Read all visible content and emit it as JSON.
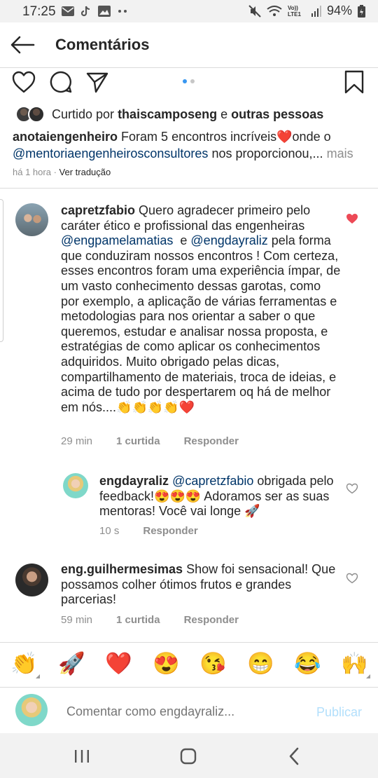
{
  "status_bar": {
    "time": "17:25",
    "network": "Vo)) LTE1",
    "battery": "94%"
  },
  "header": {
    "title": "Comentários",
    "back_icon": "arrow-left-icon"
  },
  "post": {
    "carousel_pages": 2,
    "carousel_active": 1,
    "liked_by_prefix": "Curtido por",
    "liked_by_user": "thaiscamposeng",
    "liked_by_connector": "e",
    "liked_by_others": "outras pessoas",
    "caption_user": "anotaiengenheiro",
    "caption_text": "Foram 5 encontros incríveis❤️onde o",
    "caption_mention": "@mentoriaengenheirosconsultores",
    "caption_text2": "nos proporcionou,...",
    "caption_more": "mais",
    "time_ago": "há 1 hora",
    "meta_sep": "·",
    "translate": "Ver tradução"
  },
  "comments": [
    {
      "user": "capretzfabio",
      "text_1": "Quero agradecer primeiro pelo caráter ético e profissional das engenheiras",
      "mention_1": "@engpamelamatias",
      "text_2": "e",
      "mention_2": "@engdayraliz",
      "text_3": "pela forma que conduziram nossos encontros ! Com certeza, esses encontros foram uma experiência ímpar, de um vasto conhecimento dessas garotas, como por exemplo, a aplicação de várias ferramentas e metodologias para nos orientar a saber o que queremos, estudar e analisar nossa proposta, e  estratégias de como aplicar os conhecimentos adquiridos. Muito obrigado pelas dicas, compartilhamento de materiais, troca de ideias, e acima de tudo por despertarem oq há de melhor em nós....👏👏👏👏❤️",
      "time": "29 min",
      "likes": "1 curtida",
      "reply": "Responder",
      "liked": true
    },
    {
      "user": "engdayraliz",
      "mention_1": "@capretzfabio",
      "text_1": "obrigada pelo feedback!😍😍😍 Adoramos ser as suas mentoras! Você vai longe 🚀",
      "time": "10 s",
      "reply": "Responder",
      "liked": false
    },
    {
      "user": "eng.guilhermesimas",
      "text_1": "Show foi sensacional! Que possamos colher ótimos frutos e grandes parcerias!",
      "time": "59 min",
      "likes": "1 curtida",
      "reply": "Responder",
      "liked": false
    }
  ],
  "emoji_bar": [
    "👏",
    "🚀",
    "❤️",
    "😍",
    "😘",
    "😁",
    "😂",
    "🙌"
  ],
  "composer": {
    "placeholder": "Comentar como engdayraliz...",
    "post_label": "Publicar"
  },
  "colors": {
    "link": "#003569",
    "like_red": "#ed4956",
    "muted": "#8e8e8e",
    "publish_disabled": "#b2dffc",
    "carousel_active": "#3897f0"
  }
}
